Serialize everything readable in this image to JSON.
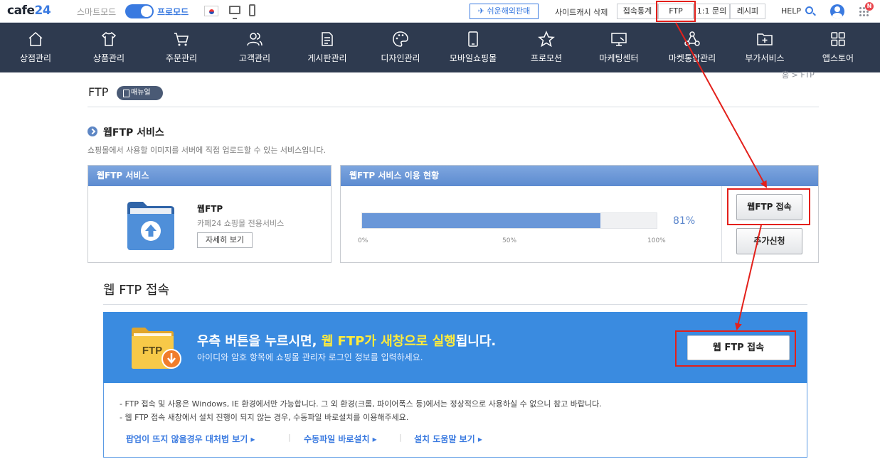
{
  "topbar": {
    "logo_main": "cafe",
    "logo_num": "24",
    "mode_smart": "스마트모드",
    "mode_pro": "프로모드",
    "easy_global_btn": "쉬운해외판매",
    "site_cache_delete": "사이트캐시 삭제",
    "buttons": [
      "접속통계",
      "FTP",
      "1:1 문의",
      "레시피"
    ],
    "help": "HELP",
    "notification_badge": "N"
  },
  "nav": {
    "items": [
      {
        "label": "상점관리",
        "icon": "home-icon"
      },
      {
        "label": "상품관리",
        "icon": "shirt-icon"
      },
      {
        "label": "주문관리",
        "icon": "cart-icon"
      },
      {
        "label": "고객관리",
        "icon": "people-icon"
      },
      {
        "label": "게시판관리",
        "icon": "document-icon"
      },
      {
        "label": "디자인관리",
        "icon": "palette-icon"
      },
      {
        "label": "모바일쇼핑몰",
        "icon": "mobile-icon"
      },
      {
        "label": "프로모션",
        "icon": "star-icon"
      },
      {
        "label": "마케팅센터",
        "icon": "monitor-icon"
      },
      {
        "label": "마켓통합관리",
        "icon": "nodes-icon"
      },
      {
        "label": "부가서비스",
        "icon": "folder-plus-icon"
      },
      {
        "label": "앱스토어",
        "icon": "apps-icon"
      }
    ]
  },
  "page": {
    "title": "FTP",
    "manual_label": "매뉴얼",
    "breadcrumb": "홈 > FTP"
  },
  "section": {
    "title": "웹FTP 서비스",
    "description": "쇼핑몰에서 사용할 이미지를 서버에 직접 업로드할 수 있는 서비스입니다."
  },
  "service_panel": {
    "header": "웹FTP 서비스",
    "name": "웹FTP",
    "subtitle": "카페24 쇼핑몰 전용서비스",
    "detail_button": "자세히 보기"
  },
  "usage_panel": {
    "header": "웹FTP 서비스 이용 현황",
    "usage_percent": 81,
    "usage_label": "81%",
    "ticks": [
      "0%",
      "50%",
      "100%"
    ],
    "connect_button": "웹FTP 접속",
    "add_button": "추가신청"
  },
  "web_ftp": {
    "heading": "웹 FTP 접속",
    "folder_label": "FTP",
    "banner_text_before": "우측 버튼을 누르시면, ",
    "banner_text_highlight": "웹 FTP가 새창으로 실행",
    "banner_text_after": "됩니다.",
    "banner_sub": "아이디와 암호 항목에 쇼핑몰 관리자 로그인 정보를 입력하세요.",
    "connect_button": "웹 FTP 접속",
    "notices": [
      "- FTP 접속 및 사용은 Windows, IE 환경에서만 가능합니다. 그 외 환경(크롬, 파이어폭스 등)에서는 정상적으로 사용하실 수 없으니 참고 바랍니다.",
      "- 웹 FTP 접속 새창에서 설치 진행이 되지 않는 경우, 수동파일 바로설치를 이용해주세요."
    ],
    "links": [
      "팝업이 뜨지 않을경우 대처법 보기 ▸",
      "수동파일 바로설치 ▸",
      "설치 도움말 보기 ▸"
    ],
    "link_separator": "|"
  },
  "colors": {
    "nav_bg": "#2e3a4f",
    "accent": "#3a7ae0",
    "banner_bg": "#3a8be0",
    "annotation_red": "#e3201b"
  }
}
